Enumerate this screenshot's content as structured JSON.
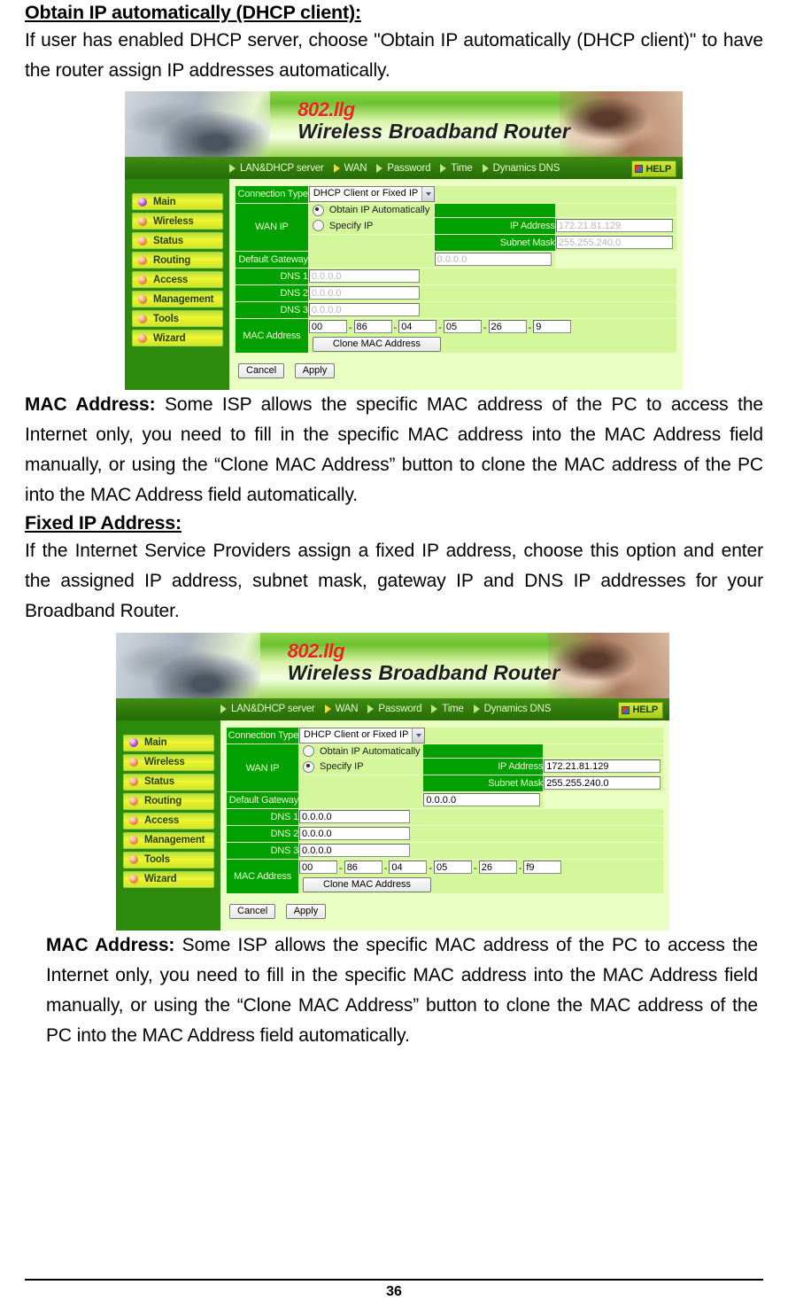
{
  "document": {
    "section1_heading": "Obtain IP automatically (DHCP client):",
    "section1_paragraph": "If user has enabled DHCP server, choose \"Obtain IP automatically (DHCP client)\" to have the router assign IP addresses automatically.",
    "mac_paragraph_label": "MAC Address:",
    "mac_paragraph_body": " Some ISP allows the specific MAC address of the PC to access the Internet only, you need to fill in the specific MAC address into the MAC Address field manually, or using the “Clone MAC Address” button to clone the MAC address of the PC into the MAC Address field automatically.",
    "section2_heading": "Fixed IP Address:",
    "section2_paragraph": "If the Internet Service Providers assign a fixed IP address, choose this option and enter the assigned IP address, subnet mask, gateway IP and DNS IP addresses for your Broadband Router.",
    "page_number": "36"
  },
  "router_ui": {
    "banner": {
      "brand_line1": "802.llg",
      "brand_line2": "Wireless  Broadband  Router",
      "brand_color": "#e8241b"
    },
    "nav": {
      "items": [
        {
          "label": "LAN&DHCP server",
          "active": false
        },
        {
          "label": "WAN",
          "active": true
        },
        {
          "label": "Password",
          "active": false
        },
        {
          "label": "Time",
          "active": false
        },
        {
          "label": "Dynamics DNS",
          "active": false
        }
      ],
      "help_label": "HELP"
    },
    "sidebar": {
      "items": [
        {
          "label": "Main",
          "active": true
        },
        {
          "label": "Wireless",
          "active": false
        },
        {
          "label": "Status",
          "active": false
        },
        {
          "label": "Routing",
          "active": false
        },
        {
          "label": "Access",
          "active": false
        },
        {
          "label": "Management",
          "active": false
        },
        {
          "label": "Tools",
          "active": false
        },
        {
          "label": "Wizard",
          "active": false
        }
      ]
    },
    "form": {
      "connection_type_label": "Connection Type",
      "connection_type_value": "DHCP Client or Fixed IP",
      "wan_ip_label": "WAN IP",
      "obtain_auto_label": "Obtain IP Automatically",
      "specify_ip_label": "Specify IP",
      "ip_address_label": "IP Address",
      "subnet_mask_label": "Subnet Mask",
      "default_gateway_label": "Default Gateway",
      "dns1_label": "DNS 1",
      "dns2_label": "DNS 2",
      "dns3_label": "DNS 3",
      "mac_address_label": "MAC Address",
      "clone_button_label": "Clone MAC Address",
      "cancel_button_label": "Cancel",
      "apply_button_label": "Apply"
    },
    "screenshot_dhcp": {
      "selected_mode": "obtain_auto",
      "ip_address": "172.21.81.129",
      "subnet_mask": "255.255.240.0",
      "default_gateway": "0.0.0.0",
      "dns1": "0.0.0.0",
      "dns2": "0.0.0.0",
      "dns3": "0.0.0.0",
      "mac": [
        "00",
        "86",
        "04",
        "05",
        "26",
        "9"
      ]
    },
    "screenshot_fixed": {
      "selected_mode": "specify_ip",
      "ip_address": "172.21.81.129",
      "subnet_mask": "255.255.240.0",
      "default_gateway": "0.0.0.0",
      "dns1": "0.0.0.0",
      "dns2": "0.0.0.0",
      "dns3": "0.0.0.0",
      "mac": [
        "00",
        "86",
        "04",
        "05",
        "26",
        "f9"
      ]
    }
  }
}
